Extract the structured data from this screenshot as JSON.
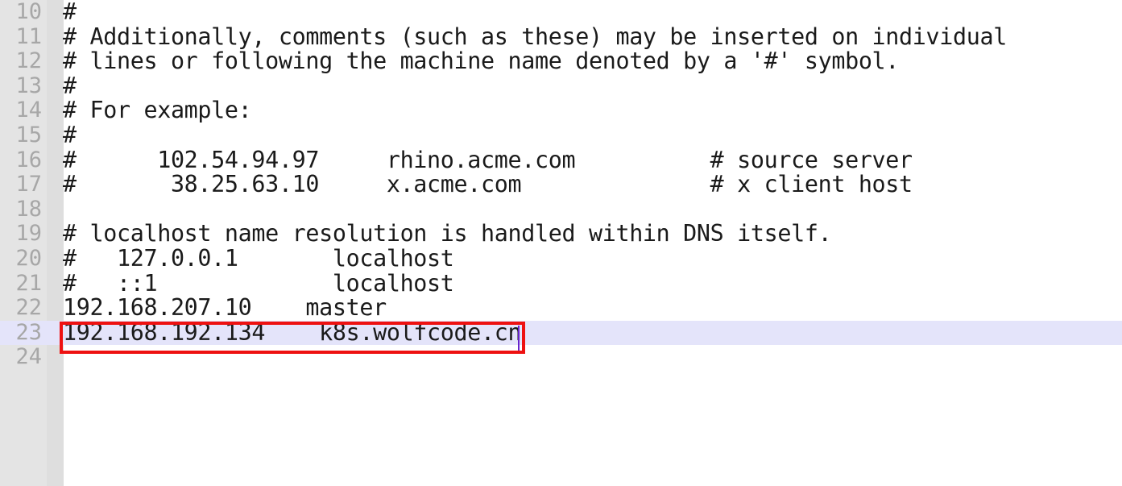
{
  "editor": {
    "file_type": "hosts-file",
    "first_line_number": 10,
    "colors": {
      "background": "#ffffff",
      "gutter_outer": "#e4e4e4",
      "gutter_inner": "#dedede",
      "line_number": "#a7a7a7",
      "text": "#1a1a1a",
      "current_line_highlight": "#e4e4fa",
      "annotation_box": "#ee1111",
      "caret": "#6622cc"
    }
  },
  "lines": [
    {
      "number": "10",
      "text": "#",
      "highlight": false
    },
    {
      "number": "11",
      "text": "# Additionally, comments (such as these) may be inserted on individual",
      "highlight": false
    },
    {
      "number": "12",
      "text": "# lines or following the machine name denoted by a '#' symbol.",
      "highlight": false
    },
    {
      "number": "13",
      "text": "#",
      "highlight": false
    },
    {
      "number": "14",
      "text": "# For example:",
      "highlight": false
    },
    {
      "number": "15",
      "text": "#",
      "highlight": false
    },
    {
      "number": "16",
      "text": "#      102.54.94.97     rhino.acme.com          # source server",
      "highlight": false
    },
    {
      "number": "17",
      "text": "#       38.25.63.10     x.acme.com              # x client host",
      "highlight": false
    },
    {
      "number": "18",
      "text": "",
      "highlight": false
    },
    {
      "number": "19",
      "text": "# localhost name resolution is handled within DNS itself.",
      "highlight": false
    },
    {
      "number": "20",
      "text": "#   127.0.0.1       localhost",
      "highlight": false
    },
    {
      "number": "21",
      "text": "#   ::1             localhost",
      "highlight": false
    },
    {
      "number": "22",
      "text": "192.168.207.10    master",
      "highlight": false
    },
    {
      "number": "23",
      "text": "192.168.192.134    k8s.wolfcode.cn",
      "highlight": true
    },
    {
      "number": "24",
      "text": "",
      "highlight": false
    }
  ],
  "annotation": {
    "name": "red-highlight-rectangle",
    "targets_line": "23",
    "target_text": "192.168.192.134    k8s.wolfcode.cn"
  },
  "caret": {
    "line": "23",
    "after_text": "k8s.wolfcode.cn"
  }
}
